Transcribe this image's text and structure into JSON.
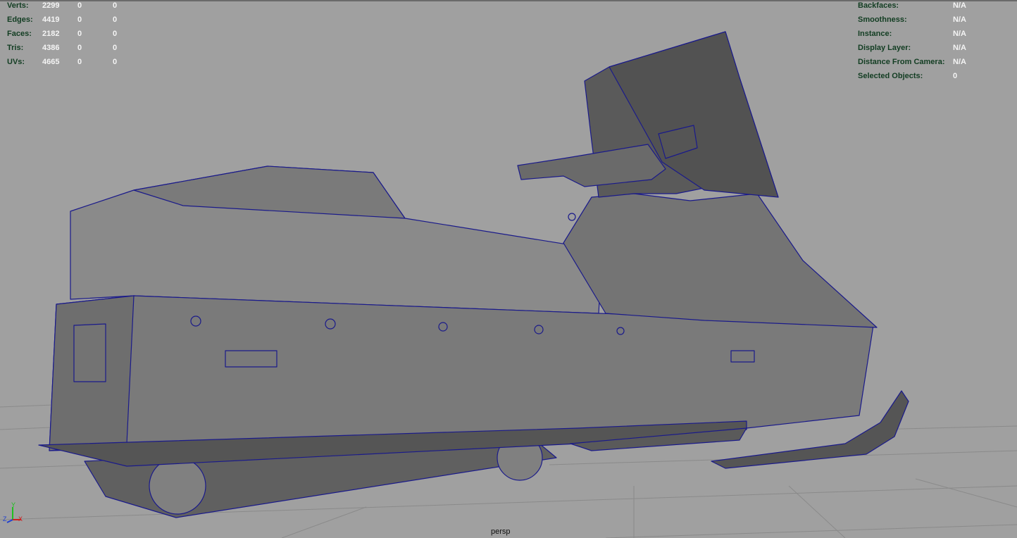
{
  "hud_left": [
    {
      "label": "Verts:",
      "v1": "2299",
      "v2": "0",
      "v3": "0"
    },
    {
      "label": "Edges:",
      "v1": "4419",
      "v2": "0",
      "v3": "0"
    },
    {
      "label": "Faces:",
      "v1": "2182",
      "v2": "0",
      "v3": "0"
    },
    {
      "label": "Tris:",
      "v1": "4386",
      "v2": "0",
      "v3": "0"
    },
    {
      "label": "UVs:",
      "v1": "4665",
      "v2": "0",
      "v3": "0"
    }
  ],
  "hud_right": [
    {
      "label": "Backfaces:",
      "value": "N/A"
    },
    {
      "label": "Smoothness:",
      "value": "N/A"
    },
    {
      "label": "Instance:",
      "value": "N/A"
    },
    {
      "label": "Display Layer:",
      "value": "N/A"
    },
    {
      "label": "Distance From Camera:",
      "value": "N/A"
    },
    {
      "label": "Selected Objects:",
      "value": "0"
    }
  ],
  "camera_label": "persp",
  "axis": {
    "x": "X",
    "y": "Y",
    "z": "Z"
  },
  "colors": {
    "background": "#a0a0a0",
    "wire": "#1a1a8a",
    "hud_label": "#123d22",
    "hud_value": "#f4f4f4"
  }
}
